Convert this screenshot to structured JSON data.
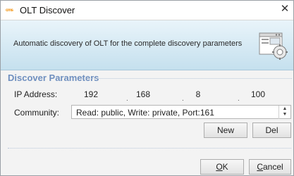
{
  "window": {
    "title": "OLT Discover",
    "app_icon_text": "cms",
    "close_glyph": "✕"
  },
  "banner": {
    "description": "Automatic discovery of OLT for the complete discovery parameters",
    "icon": "discover-settings-icon"
  },
  "section": {
    "title": "Discover Parameters"
  },
  "ip": {
    "label": "IP Address:",
    "octets": [
      "192",
      "168",
      "8",
      "100"
    ]
  },
  "community": {
    "label": "Community:",
    "selected": "Read: public, Write: private, Port:161"
  },
  "buttons": {
    "new": "New",
    "del": "Del",
    "ok": "OK",
    "ok_mnemonic": "O",
    "ok_rest": "K",
    "cancel": "Cancel",
    "cancel_mnemonic": "C",
    "cancel_rest": "ancel"
  }
}
